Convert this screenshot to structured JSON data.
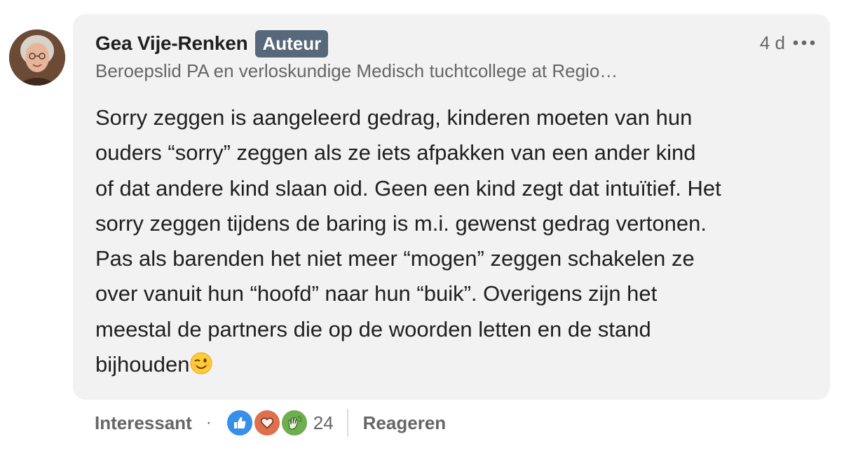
{
  "author": {
    "name": "Gea Vije-Renken",
    "badge": "Auteur",
    "headline": "Beroepslid PA en verloskundige Medisch tuchtcollege at Regio…",
    "avatar_icon": "profile-photo"
  },
  "meta": {
    "time": "4 d",
    "more_icon": "ellipsis-icon"
  },
  "comment": {
    "text": "Sorry zeggen is aangeleerd gedrag, kinderen moeten van hun\nouders “sorry” zeggen als ze iets afpakken van een ander kind\nof dat andere kind slaan oid. Geen een kind zegt dat intuïtief. Het\nsorry zeggen tijdens de baring is m.i. gewenst gedrag vertonen.\nPas als barenden het niet meer “mogen” zeggen schakelen ze\nover vanuit hun “hoofd” naar hun “buik”. Overigens zijn het\nmeestal de partners die op de woorden letten en de stand\nbijhouden",
    "emoji": "winking-face"
  },
  "actions": {
    "reaction_label": "Interessant",
    "separator": "·",
    "reaction_icons": [
      "like-icon",
      "love-icon",
      "celebrate-icon"
    ],
    "reaction_count": "24",
    "reply_label": "Reageren"
  },
  "colors": {
    "bubble_bg": "#f2f2f2",
    "badge_bg": "#56687a",
    "like": "#378fe9",
    "love": "#df704d",
    "celebrate": "#6dae4f",
    "text_primary": "#1f1f1f",
    "text_secondary": "#666666"
  }
}
